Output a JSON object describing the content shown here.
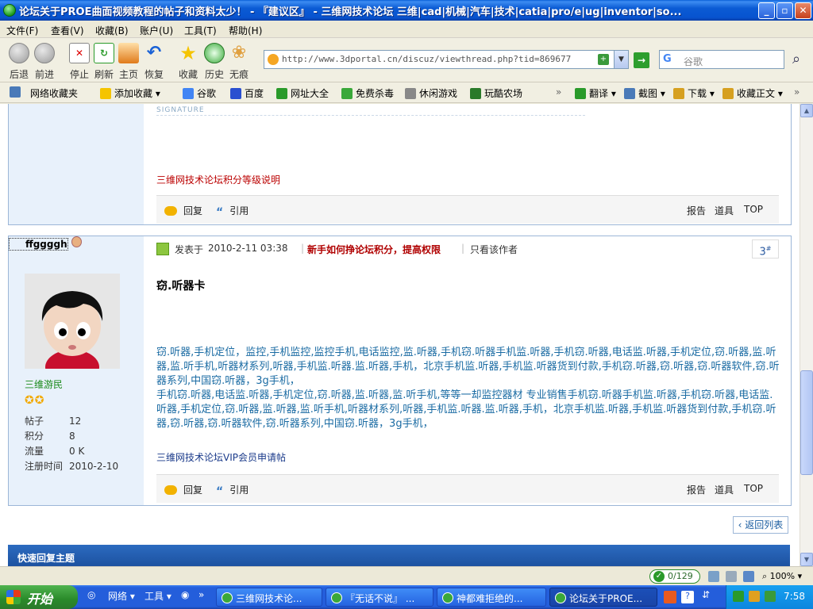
{
  "window": {
    "title": "论坛关于PROE曲面视频教程的帖子和资料太少！ - 『建议区』 - 三维网技术论坛 三维|cad|机械|汽车|技术|catia|pro/e|ug|inventor|so...",
    "min": "_",
    "max": "▫",
    "close": "✕"
  },
  "menu": [
    "文件(F)",
    "查看(V)",
    "收藏(B)",
    "账户(U)",
    "工具(T)",
    "帮助(H)"
  ],
  "toolbar": {
    "back": "后退",
    "forward": "前进",
    "stop": "停止",
    "refresh": "刷新",
    "home": "主页",
    "restore": "恢复",
    "favorites": "收藏",
    "history": "历史",
    "incognito": "无痕"
  },
  "address": {
    "url": "http://www.3dportal.cn/discuz/viewthread.php?tid=869677"
  },
  "search": {
    "engine": "G",
    "placeholder": "谷歌"
  },
  "favbar": {
    "items": [
      "网络收藏夹",
      "添加收藏",
      "谷歌",
      "百度",
      "网址大全",
      "免费杀毒",
      "休闲游戏",
      "玩酷农场"
    ],
    "right": [
      "翻译",
      "截图",
      "下载",
      "收藏正文"
    ],
    "more": "»"
  },
  "post_prev": {
    "sig_label": "SIGNATURE",
    "credit_link": "三维网技术论坛积分等级说明",
    "actions": {
      "reply": "回复",
      "quote": "引用",
      "report": "报告",
      "tools": "道具",
      "top": "TOP"
    }
  },
  "post3": {
    "username": "ffggggh",
    "rank": "三维游民",
    "stats": [
      {
        "label": "帖子",
        "value": "12"
      },
      {
        "label": "积分",
        "value": "8"
      },
      {
        "label": "流量",
        "value": "0 K"
      },
      {
        "label": "注册时间",
        "value": "2010-2-10"
      }
    ],
    "posted_prefix": "发表于",
    "posted_time": "2010-2-11 03:38",
    "notice": "新手如何挣论坛积分，提高权限",
    "only_author": "只看该作者",
    "floor": "3",
    "floor_sup": "#",
    "title": "窃.听器卡",
    "body1": "窃.听器,手机定位，监控,手机监控,监控手机,电话监控,监.听器,手机窃.听器手机监.听器,手机窃.听器,电话监.听器,手机定位,窃.听器,监.听器,监.听手机,听器材系列,听器,手机监.听器.监.听器,手机，北京手机监.听器,手机监.听器货到付款,手机窃.听器,窃.听器,窃.听器软件,窃.听器系列,中国窃.听器，3g手机，",
    "body2": "手机窃.听器,电话监.听器,手机定位,窃.听器,监.听器,监.听手机,等等一却监控器材 专业销售手机窃.听器手机监.听器,手机窃.听器,电话监.听器,手机定位,窃.听器,监.听器,监.听手机,听器材系列,听器,手机监.听器.监.听器,手机，北京手机监.听器,手机监.听器货到付款,手机窃.听器,窃.听器,窃.听器软件,窃.听器系列,中国窃.听器，3g手机，",
    "vip_link": "三维网技术论坛VIP会员申请帖",
    "actions": {
      "reply": "回复",
      "quote": "引用",
      "report": "报告",
      "tools": "道具",
      "top": "TOP"
    }
  },
  "back_to_list": "返回列表",
  "quick_reply": "快速回复主题",
  "status": {
    "count": "0/129",
    "zoom": "100%"
  },
  "taskbar": {
    "start": "开始",
    "quicklaunch": [
      "网络",
      "工具"
    ],
    "tasks": [
      "三维网技术论...",
      "『无话不说』 ...",
      "神都难拒绝的...",
      "论坛关于PROE..."
    ],
    "clock": "7:58"
  },
  "colors": {
    "titlebar": "#0b5bd4",
    "post_text": "#1a6ba3",
    "notice_red": "#b00000",
    "side_bg": "#e8f1fb"
  }
}
